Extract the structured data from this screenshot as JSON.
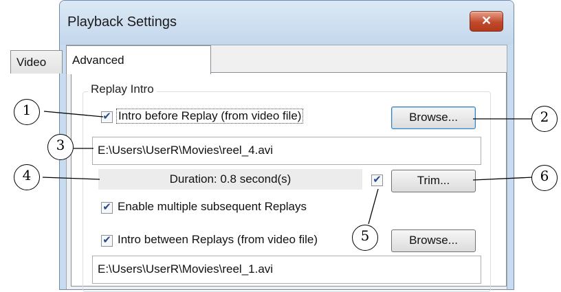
{
  "window": {
    "title": "Playback Settings",
    "close_icon": "close-icon"
  },
  "tabs": [
    {
      "label": "Video",
      "active": false
    },
    {
      "label": "Advanced",
      "active": true
    }
  ],
  "group": {
    "title": "Replay Intro",
    "intro_before": {
      "label": "Intro before Replay (from video file)",
      "checked": true,
      "browse_label": "Browse..."
    },
    "intro_before_path": "E:\\Users\\UserR\\Movies\\reel_4.avi",
    "duration_text": "Duration: 0.8 second(s)",
    "trim": {
      "checked": true,
      "label": "Trim..."
    },
    "enable_multiple": {
      "label": "Enable multiple subsequent Replays",
      "checked": true
    },
    "intro_between": {
      "label": "Intro between Replays (from video file)",
      "checked": true,
      "browse_label": "Browse..."
    },
    "intro_between_path": "E:\\Users\\UserR\\Movies\\reel_1.avi"
  },
  "callouts": [
    "1",
    "2",
    "3",
    "4",
    "5",
    "6"
  ]
}
